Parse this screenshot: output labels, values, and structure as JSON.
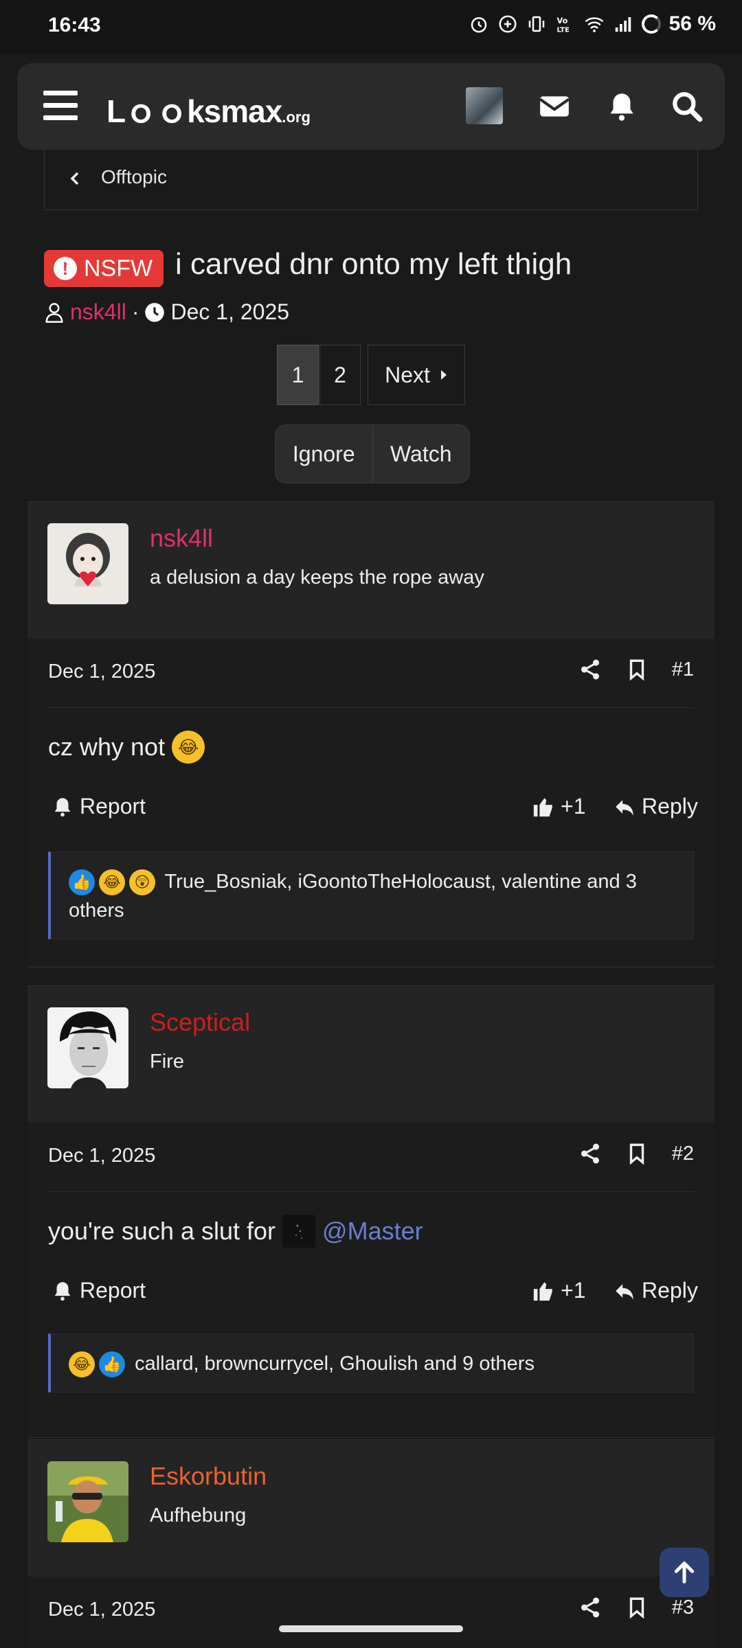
{
  "status_bar": {
    "time": "16:43",
    "battery": "56 %"
  },
  "header": {
    "logo_main": "Lｏｏksmax",
    "logo_suffix": ".org"
  },
  "breadcrumb": {
    "label": "Offtopic"
  },
  "thread": {
    "prefix": "NSFW",
    "title": "i carved dnr onto my left thigh",
    "author": "nsk4ll",
    "separator": "·",
    "date": "Dec 1, 2025"
  },
  "pagination": {
    "page1": "1",
    "page2": "2",
    "next": "Next"
  },
  "thread_actions": {
    "ignore": "Ignore",
    "watch": "Watch"
  },
  "posts": [
    {
      "username": "nsk4ll",
      "username_color": "#e0316d",
      "user_title": "a delusion a day keeps the rope away",
      "date": "Dec 1, 2025",
      "number": "#1",
      "text": "cz why not",
      "report": "Report",
      "likes": "+1",
      "reply": "Reply",
      "reactions_text": "True_Bosniak, iGoontoTheHolocaust, valentine and 3 others"
    },
    {
      "username": "Sceptical",
      "username_color": "#cc1f1f",
      "user_title": "Fire",
      "date": "Dec 1, 2025",
      "number": "#2",
      "text": "you're such a slut for",
      "mention": "@Master",
      "report": "Report",
      "likes": "+1",
      "reply": "Reply",
      "reactions_text": "callard, browncurrycel, Ghoulish and 9 others"
    },
    {
      "username": "Eskorbutin",
      "username_color": "#e8642c",
      "user_title": "Aufhebung",
      "date": "Dec 1, 2025",
      "number": "#3"
    }
  ],
  "colors": {
    "accent": "#5a6ac8",
    "nsfw": "#e53935",
    "background": "#1a1a1a"
  }
}
